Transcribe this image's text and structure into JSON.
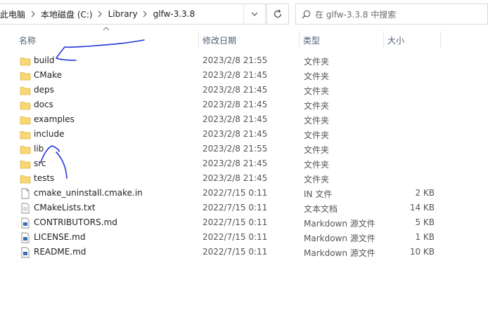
{
  "address_bar": {
    "crumbs": [
      "此电脑",
      "本地磁盘 (C:)",
      "Library",
      "glfw-3.3.8"
    ]
  },
  "search": {
    "placeholder": "在 glfw-3.3.8 中搜索"
  },
  "columns": {
    "name": "名称",
    "date": "修改日期",
    "type": "类型",
    "size": "大小"
  },
  "files": [
    {
      "name": "build",
      "date": "2023/2/8 21:55",
      "type": "文件夹",
      "size": "",
      "icon": "folder"
    },
    {
      "name": "CMake",
      "date": "2023/2/8 21:45",
      "type": "文件夹",
      "size": "",
      "icon": "folder"
    },
    {
      "name": "deps",
      "date": "2023/2/8 21:45",
      "type": "文件夹",
      "size": "",
      "icon": "folder"
    },
    {
      "name": "docs",
      "date": "2023/2/8 21:45",
      "type": "文件夹",
      "size": "",
      "icon": "folder"
    },
    {
      "name": "examples",
      "date": "2023/2/8 21:45",
      "type": "文件夹",
      "size": "",
      "icon": "folder"
    },
    {
      "name": "include",
      "date": "2023/2/8 21:45",
      "type": "文件夹",
      "size": "",
      "icon": "folder"
    },
    {
      "name": "lib",
      "date": "2023/2/8 21:55",
      "type": "文件夹",
      "size": "",
      "icon": "folder"
    },
    {
      "name": "src",
      "date": "2023/2/8 21:45",
      "type": "文件夹",
      "size": "",
      "icon": "folder"
    },
    {
      "name": "tests",
      "date": "2023/2/8 21:45",
      "type": "文件夹",
      "size": "",
      "icon": "folder"
    },
    {
      "name": "cmake_uninstall.cmake.in",
      "date": "2022/7/15 0:11",
      "type": "IN 文件",
      "size": "2 KB",
      "icon": "file"
    },
    {
      "name": "CMakeLists.txt",
      "date": "2022/7/15 0:11",
      "type": "文本文档",
      "size": "14 KB",
      "icon": "text-file"
    },
    {
      "name": "CONTRIBUTORS.md",
      "date": "2022/7/15 0:11",
      "type": "Markdown 源文件",
      "size": "5 KB",
      "icon": "markdown-file"
    },
    {
      "name": "LICENSE.md",
      "date": "2022/7/15 0:11",
      "type": "Markdown 源文件",
      "size": "1 KB",
      "icon": "markdown-file"
    },
    {
      "name": "README.md",
      "date": "2022/7/15 0:11",
      "type": "Markdown 源文件",
      "size": "10 KB",
      "icon": "markdown-file"
    }
  ],
  "colors": {
    "folder": "#f8d775",
    "annotation": "#1f35d6",
    "header_text": "#4c607a"
  }
}
